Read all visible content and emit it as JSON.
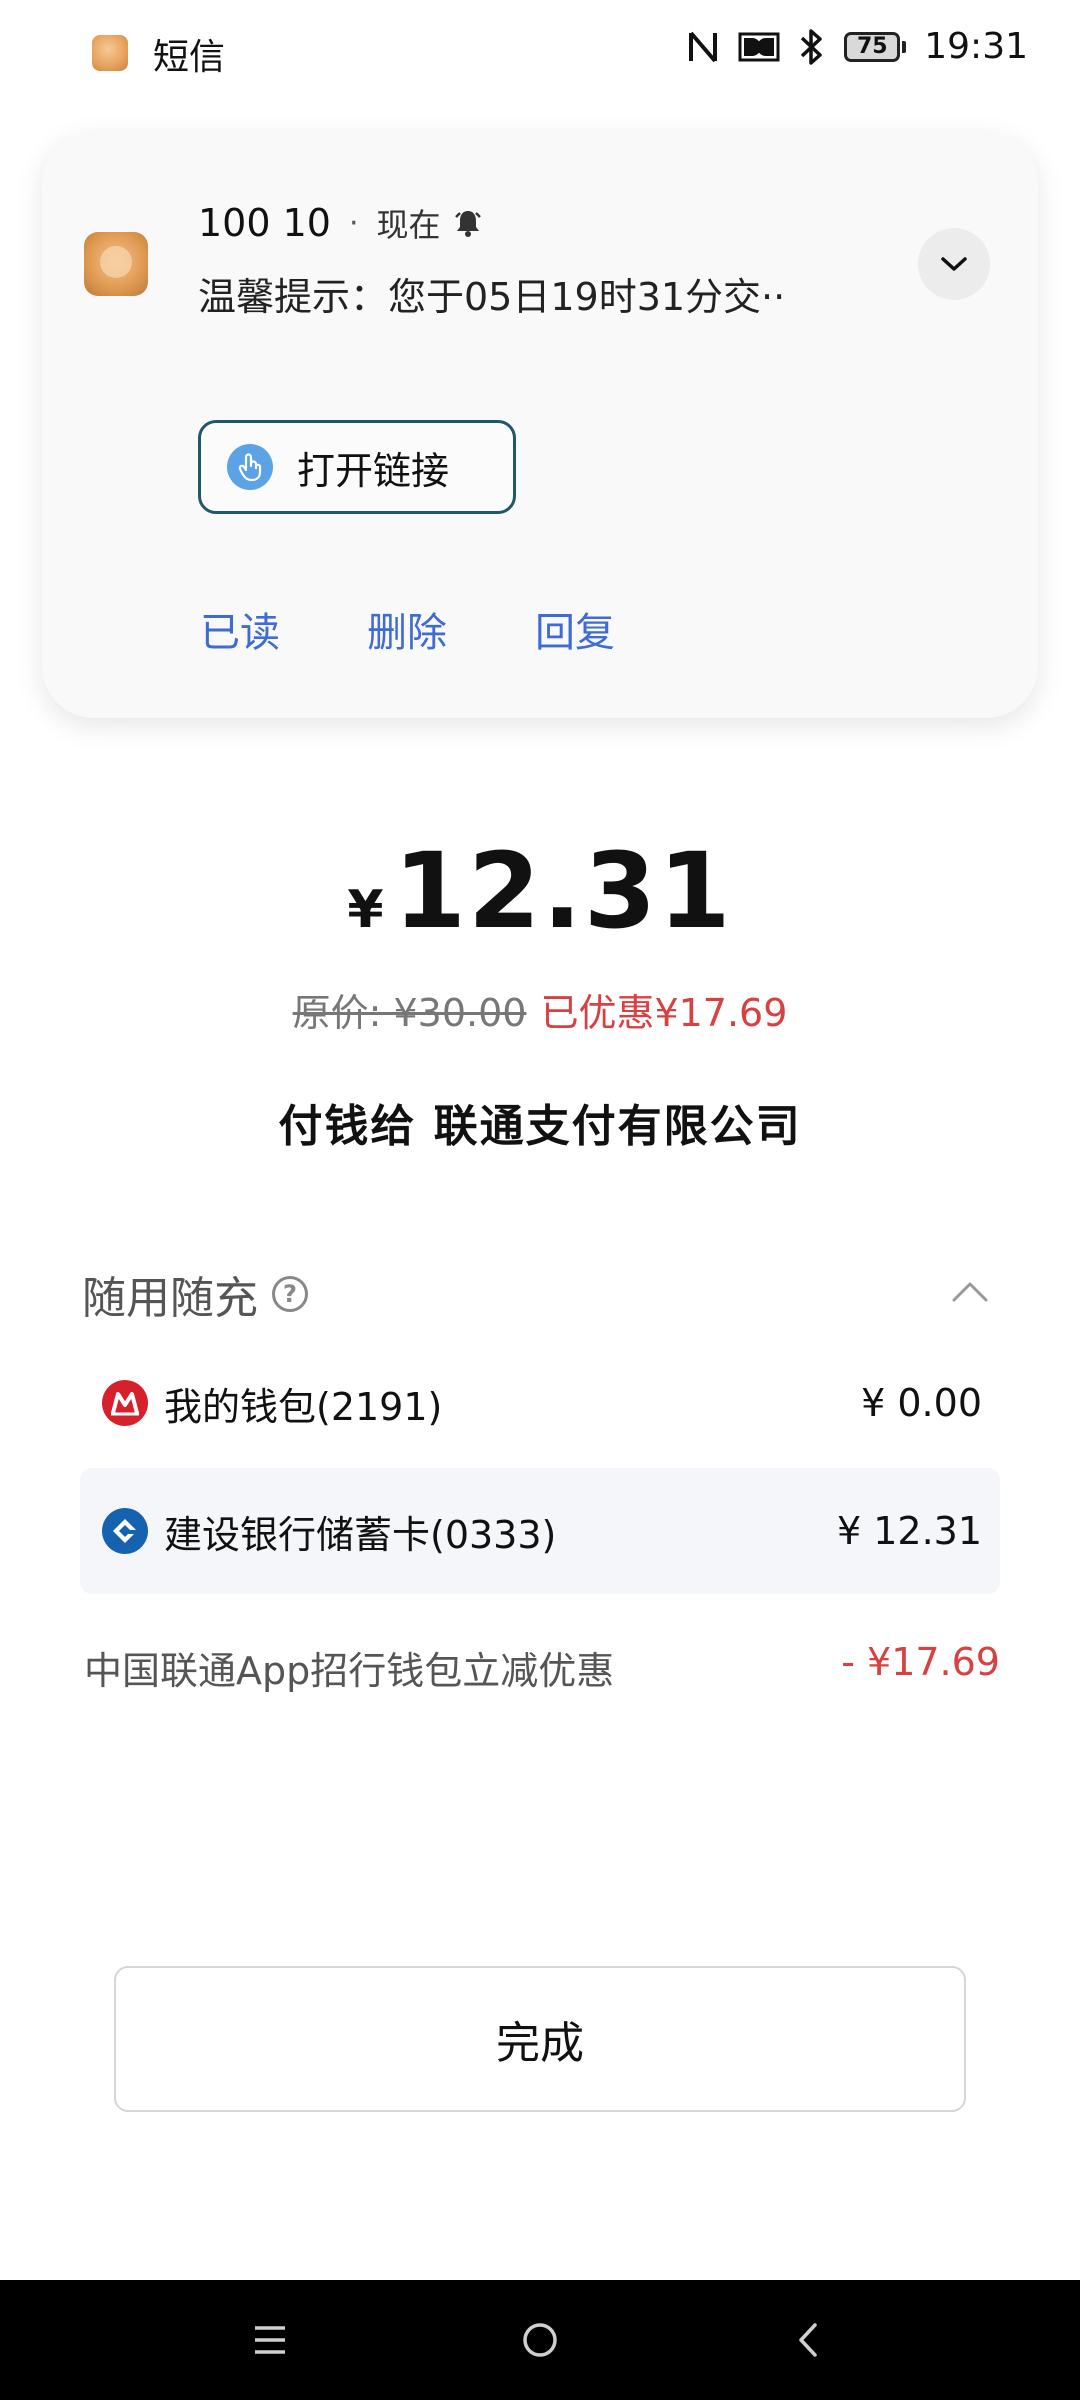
{
  "status_bar": {
    "app_name": "短信",
    "battery": "75",
    "time": "19:31"
  },
  "notification": {
    "sender": "100 10",
    "separator": "·",
    "time": "现在",
    "message": "温馨提示：您于05日19时31分交··",
    "open_link_label": "打开链接",
    "actions": [
      "已读",
      "删除",
      "回复"
    ]
  },
  "payment": {
    "currency_symbol": "¥",
    "amount": "12.31",
    "original_price": "原价: ¥30.00",
    "saved": "已优惠¥17.69",
    "payee": "付钱给 联通支付有限公司"
  },
  "methods": {
    "title": "随用随充",
    "help_glyph": "?",
    "items": [
      {
        "label": "我的钱包(2191)",
        "amount": "¥ 0.00",
        "icon": "cmb-logo-icon"
      },
      {
        "label": "建设银行储蓄卡(0333)",
        "amount": "¥ 12.31",
        "icon": "ccb-logo-icon"
      }
    ],
    "promo_label": "中国联通App招行钱包立减优惠",
    "promo_amount": "- ¥17.69"
  },
  "done_label": "完成",
  "colors": {
    "link_blue": "#3f6cd2",
    "discount_red": "#d94040",
    "button_border": "#1f5866"
  }
}
